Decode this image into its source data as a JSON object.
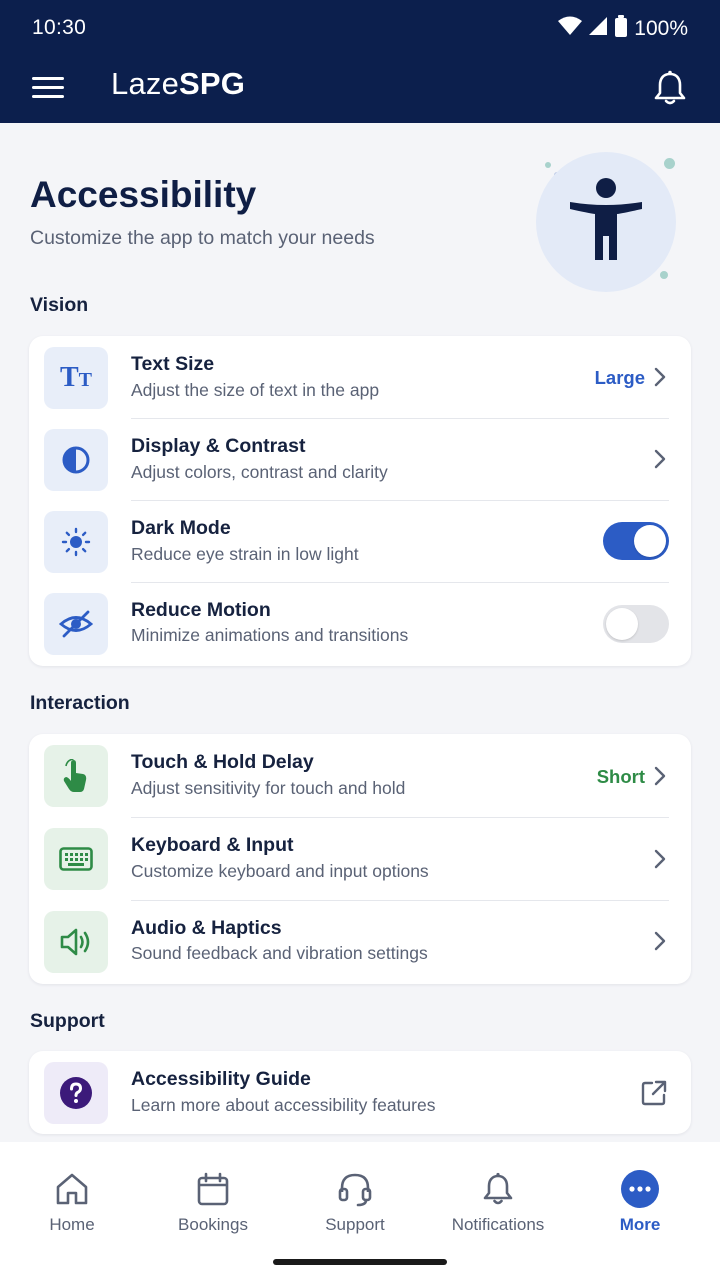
{
  "status_bar": {
    "time": "10:30",
    "battery": "100%"
  },
  "app_bar": {
    "brand_light": "Laze",
    "brand_bold": "SPG"
  },
  "hero": {
    "title": "Accessibility",
    "subtitle": "Customize the app to match your needs"
  },
  "sections": {
    "vision": {
      "label": "Vision",
      "items": [
        {
          "title": "Text Size",
          "description": "Adjust the size of text in the app",
          "value": "Large",
          "icon": "text-size-icon"
        },
        {
          "title": "Display & Contrast",
          "description": "Adjust colors, contrast and clarity",
          "icon": "contrast-icon"
        },
        {
          "title": "Dark Mode",
          "description": "Reduce eye strain in low light",
          "toggle": true,
          "icon": "sun-icon"
        },
        {
          "title": "Reduce Motion",
          "description": "Minimize animations and transitions",
          "toggle": false,
          "icon": "eye-off-icon"
        }
      ]
    },
    "interaction": {
      "label": "Interaction",
      "items": [
        {
          "title": "Touch & Hold Delay",
          "description": "Adjust sensitivity for touch and hold",
          "value": "Short",
          "icon": "touch-icon"
        },
        {
          "title": "Keyboard & Input",
          "description": "Customize keyboard and input options",
          "icon": "keyboard-icon"
        },
        {
          "title": "Audio & Haptics",
          "description": "Sound feedback and vibration settings",
          "icon": "speaker-icon"
        }
      ]
    },
    "support": {
      "label": "Support",
      "items": [
        {
          "title": "Accessibility Guide",
          "description": "Learn more about accessibility features",
          "icon": "help-icon"
        }
      ]
    }
  },
  "bottom_nav": [
    {
      "label": "Home",
      "icon": "home-icon"
    },
    {
      "label": "Bookings",
      "icon": "calendar-icon"
    },
    {
      "label": "Support",
      "icon": "headset-icon"
    },
    {
      "label": "Notifications",
      "icon": "bell-icon"
    },
    {
      "label": "More",
      "icon": "more-icon",
      "active": true
    }
  ],
  "colors": {
    "navy": "#0c1f4d",
    "accent_blue": "#2c5cc5",
    "accent_green": "#2e8b46",
    "accent_purple": "#3c1a7a"
  }
}
